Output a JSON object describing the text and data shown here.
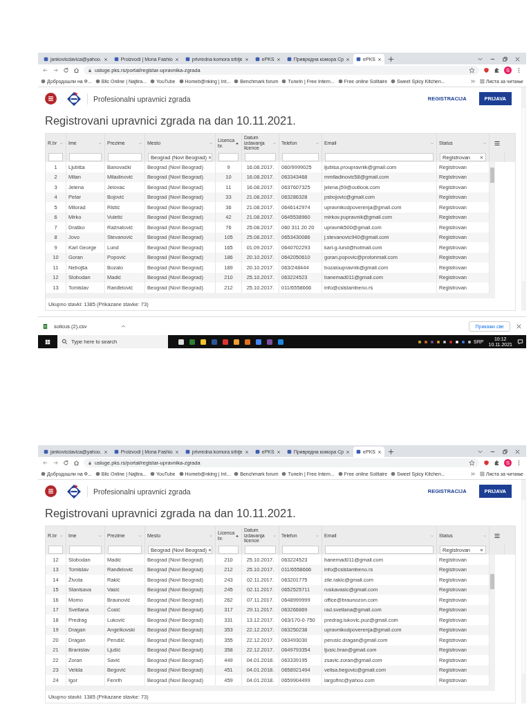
{
  "screenshots": [
    {
      "tabs": [
        {
          "title": "jankovicdavica@yahoo.",
          "selected": false
        },
        {
          "title": "Proizvodi | Mona Fashio",
          "selected": false
        },
        {
          "title": "privredna komora srbije",
          "selected": false
        },
        {
          "title": "ePKS",
          "selected": false
        },
        {
          "title": "Привредна комора Ср",
          "selected": false
        },
        {
          "title": "ePKS",
          "selected": true
        }
      ],
      "url": "usluge.pks.rs/portal/registar-upravnika-zgrada",
      "profile": "S",
      "bookmarks": [
        "Добродошли на Ф...",
        "Blic Online | Najtira...",
        "YouTube",
        "Homeb@nking | Int...",
        "Benchmark forum",
        "TuneIn | Free Intern...",
        "Free online Solitaire",
        "Sweet Spicy Kitchen..."
      ],
      "reading_list": "Листа за читање",
      "site_title": "Profesionalni upravnici zgrada",
      "register": "REGISTRACIJA",
      "login": "PRIJAVA",
      "heading": "Registrovani upravnici zgrada na dan 10.11.2021.",
      "table": {
        "columns": [
          {
            "label": "R.br",
            "sorted": false
          },
          {
            "label": "Ime",
            "sorted": false
          },
          {
            "label": "Prezime",
            "sorted": false
          },
          {
            "label": "Mesto",
            "sorted": false,
            "filter": "Beograd (Novi Beograd)"
          },
          {
            "label": "Licenca br.",
            "sorted": true
          },
          {
            "label": "Datum izdavanja licence",
            "sorted": false
          },
          {
            "label": "Telefon",
            "sorted": false
          },
          {
            "label": "Email",
            "sorted": false
          },
          {
            "label": "Status",
            "sorted": false,
            "filter": "Registrovan"
          }
        ],
        "rows": [
          [
            "1",
            "Ljubiša",
            "Banovački",
            "Beograd (Novi Beograd)",
            "9",
            "16.08.2017.",
            "060/9999025",
            "ljubisa.proupravnik@gmail.com",
            "Registrovan"
          ],
          [
            "2",
            "Milan",
            "Miladinović",
            "Beograd (Novi Beograd)",
            "10",
            "16.08.2017.",
            "063343468",
            "mmiladinovic58@gmail.com",
            "Registrovan"
          ],
          [
            "3",
            "Jelena",
            "Jelovac",
            "Beograd (Novi Beograd)",
            "11",
            "16.08.2017.",
            "0637607325",
            "jelena.j59@outlook.com",
            "Registrovan"
          ],
          [
            "4",
            "Petar",
            "Bojović",
            "Beograd (Novi Beograd)",
            "33",
            "21.08.2017.",
            "063286328",
            "psbojovic@gmail.com",
            "Registrovan"
          ],
          [
            "5",
            "Milorad",
            "Ristić",
            "Beograd (Novi Beograd)",
            "36",
            "21.08.2017.",
            "0646142974",
            "upravnikodpoverenja@gmail.com",
            "Registrovan"
          ],
          [
            "6",
            "Mirko",
            "Vuletić",
            "Beograd (Novi Beograd)",
            "42",
            "21.08.2017.",
            "0645538960",
            "mirkov.pupravnik@gmail.com",
            "Registrovan"
          ],
          [
            "7",
            "Draško",
            "Ražnatović",
            "Beograd (Novi Beograd)",
            "76",
            "25.08.2017.",
            "060 311 20 20",
            "upravnik500@gmail.com",
            "Registrovan"
          ],
          [
            "8",
            "Jovo",
            "Stevanović",
            "Beograd (Novi Beograd)",
            "105",
            "25.08.2017.",
            "0653430086",
            "j.stevanovic940@gmail.com",
            "Registrovan"
          ],
          [
            "9",
            "Karl George",
            "Lund",
            "Beograd (Novi Beograd)",
            "165",
            "01.09.2017.",
            "0640702293",
            "karl-g-lund@hotmail.com",
            "Registrovan"
          ],
          [
            "10",
            "Goran",
            "Popović",
            "Beograd (Novi Beograd)",
            "186",
            "20.10.2017.",
            "0642050610",
            "goran.popovic@protonmail.com",
            "Registrovan"
          ],
          [
            "11",
            "Nebojša",
            "Bozalo",
            "Beograd (Novi Beograd)",
            "189",
            "20.10.2017.",
            "063/248444",
            "bozaloupravnik@gmail.com",
            "Registrovan"
          ],
          [
            "12",
            "Slobodan",
            "Madić",
            "Beograd (Novi Beograd)",
            "210",
            "25.10.2017.",
            "063224523",
            "banemad011@gmail.com",
            "Registrovan"
          ],
          [
            "13",
            "Tomislav",
            "Ranđelović",
            "Beograd (Novi Beograd)",
            "212",
            "25.10.2017.",
            "011/6558666",
            "info@csistambeno.rs",
            "Registrovan"
          ]
        ],
        "footer": "Ukupno stavki: 1385 (Prikazane stavke: 73)"
      },
      "downloads": {
        "file": "solicus (2).csv",
        "show_all": "Прикажи све"
      },
      "taskbar": {
        "search_placeholder": "Type here to search",
        "language": "SRP",
        "time": "10:12",
        "date": "10.11.2021"
      }
    },
    {
      "tabs": [
        {
          "title": "jankovicdavica@yahoo.",
          "selected": false
        },
        {
          "title": "Proizvodi | Mona Fashio",
          "selected": false
        },
        {
          "title": "privredna komora srbije",
          "selected": false
        },
        {
          "title": "ePKS",
          "selected": false
        },
        {
          "title": "Привредна комора Ср",
          "selected": false
        },
        {
          "title": "ePKS",
          "selected": true
        }
      ],
      "url": "usluge.pks.rs/portal/registar-upravnika-zgrada",
      "profile": "S",
      "bookmarks": [
        "Добродошли на Ф...",
        "Blic Online | Najtira...",
        "YouTube",
        "Homeb@nking | Int...",
        "Benchmark forum",
        "TuneIn | Free Intern...",
        "Free online Solitaire",
        "Sweet Spicy Kitchen..."
      ],
      "reading_list": "Листа за читање",
      "site_title": "Profesionalni upravnici zgrada",
      "register": "REGISTRACIJA",
      "login": "PRIJAVA",
      "heading": "Registrovani upravnici zgrada na dan 10.11.2021.",
      "table": {
        "columns": [
          {
            "label": "R.br",
            "sorted": false
          },
          {
            "label": "Ime",
            "sorted": false
          },
          {
            "label": "Prezime",
            "sorted": false
          },
          {
            "label": "Mesto",
            "sorted": false,
            "filter": "Beograd (Novi Beograd)"
          },
          {
            "label": "Licenca br.",
            "sorted": true
          },
          {
            "label": "Datum izdavanja licence",
            "sorted": false
          },
          {
            "label": "Telefon",
            "sorted": false
          },
          {
            "label": "Email",
            "sorted": false
          },
          {
            "label": "Status",
            "sorted": false,
            "filter": "Registrovan"
          }
        ],
        "rows": [
          [
            "12",
            "Slobodan",
            "Madić",
            "Beograd (Novi Beograd)",
            "210",
            "25.10.2017.",
            "063224523",
            "banemad011@gmail.com",
            "Registrovan"
          ],
          [
            "13",
            "Tomislav",
            "Ranđelović",
            "Beograd (Novi Beograd)",
            "212",
            "25.10.2017.",
            "011/6558666",
            "info@csistambeno.rs",
            "Registrovan"
          ],
          [
            "14",
            "Života",
            "Rakić",
            "Beograd (Novi Beograd)",
            "243",
            "02.11.2017.",
            "063201775",
            "zile.rakic@gmail.com",
            "Registrovan"
          ],
          [
            "15",
            "Stanisava",
            "Vasić",
            "Beograd (Novi Beograd)",
            "245",
            "02.11.2017.",
            "0652525711",
            "ruskavasic@gmail.com",
            "Registrovan"
          ],
          [
            "16",
            "Momo",
            "Braunović",
            "Beograd (Novi Beograd)",
            "262",
            "07.11.2017.",
            "0648999999",
            "office@braunozon.com",
            "Registrovan"
          ],
          [
            "17",
            "Svetlana",
            "Ćosić",
            "Beograd (Novi Beograd)",
            "317",
            "29.11.2017.",
            "063266869",
            "rad.svetlana@gmail.com",
            "Registrovan"
          ],
          [
            "18",
            "Predrag",
            "Luković",
            "Beograd (Novi Beograd)",
            "331",
            "13.12.2017.",
            "063/170-0-750",
            "predrag.lukovic.puz@gmail.com",
            "Registrovan"
          ],
          [
            "19",
            "Dragan",
            "Angelkovski",
            "Beograd (Novi Beograd)",
            "353",
            "22.12.2017.",
            "063250238",
            "upravnikodpoverenja@gmail.com",
            "Registrovan"
          ],
          [
            "20",
            "Dragan",
            "Perušić",
            "Beograd (Novi Beograd)",
            "355",
            "22.12.2017.",
            "063493030",
            "perusic.dragan@gmail.com",
            "Registrovan"
          ],
          [
            "21",
            "Branislav",
            "Ljušić",
            "Beograd (Novi Beograd)",
            "358",
            "22.12.2017.",
            "0649793354",
            "ljusic.bran@gmail.com",
            "Registrovan"
          ],
          [
            "22",
            "Zoran",
            "Savić",
            "Beograd (Novi Beograd)",
            "449",
            "04.01.2018.",
            "063339195",
            "zsavic.zoran@gmail.com",
            "Registrovan"
          ],
          [
            "23",
            "Velida",
            "Begović",
            "Beograd (Novi Beograd)",
            "451",
            "04.01.2018.",
            "0658921494",
            "velisa.begovic@gmail.com",
            "Registrovan"
          ],
          [
            "24",
            "Igor",
            "Fenrih",
            "Beograd (Novi Beograd)",
            "459",
            "04.01.2018.",
            "0659904499",
            "largofinc@yahoo.com",
            "Registrovan"
          ]
        ],
        "footer": "Ukupno stavki: 1385 (Prikazane stavke: 73)"
      }
    }
  ]
}
